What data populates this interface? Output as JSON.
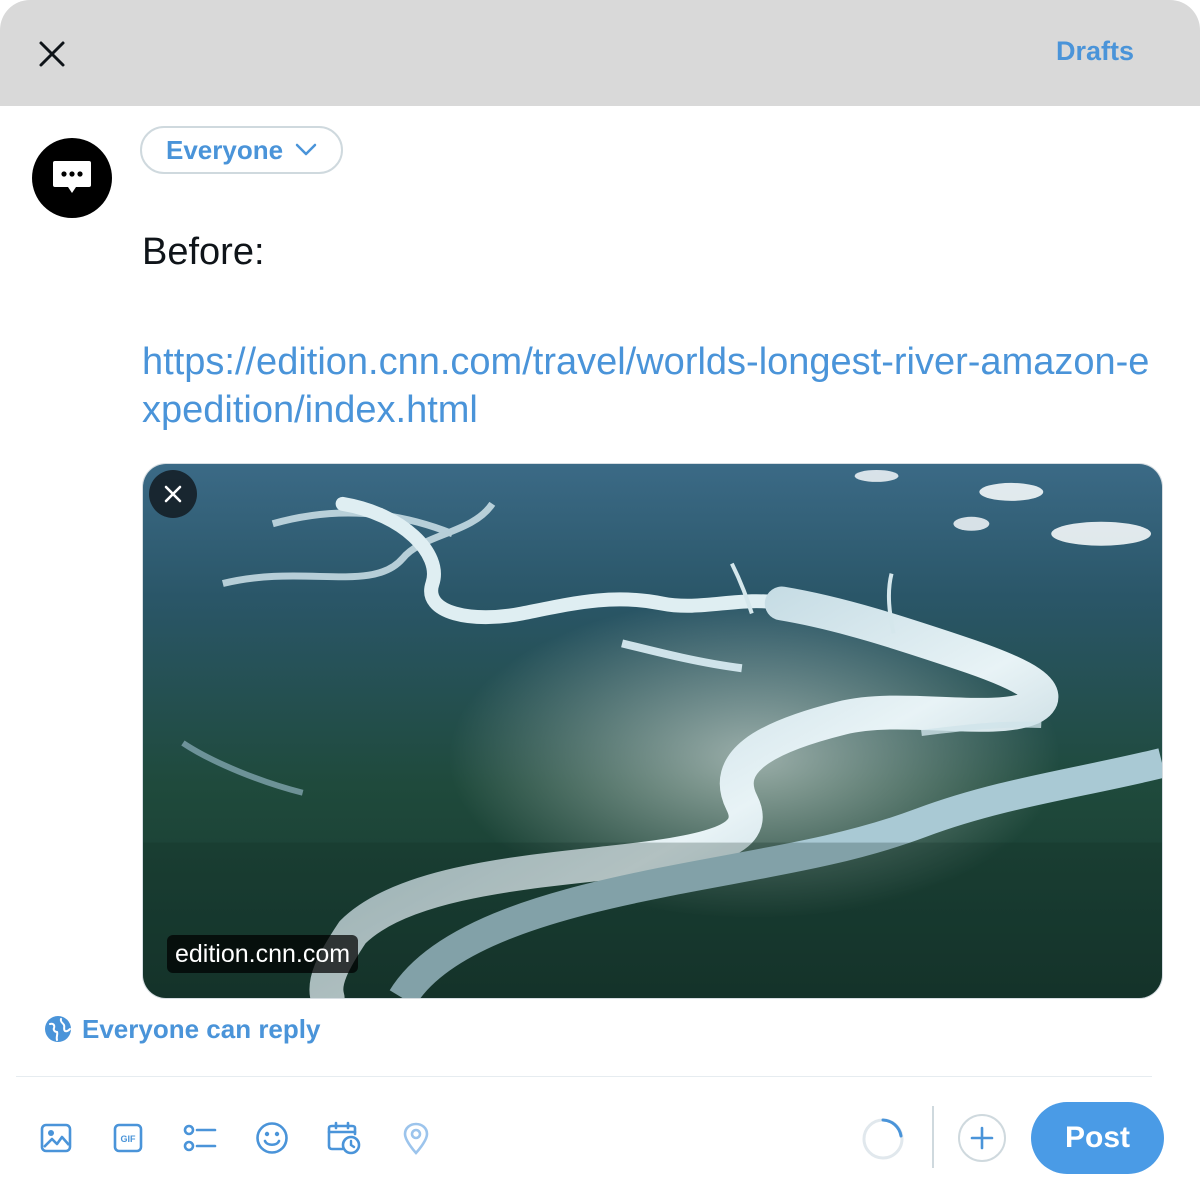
{
  "header": {
    "drafts_label": "Drafts",
    "close_icon": "close-icon"
  },
  "composer": {
    "audience_label": "Everyone",
    "text_line1": "Before:",
    "link_text": "https://edition.cnn.com/travel/worlds-longest-river-amazon-expedition/index.html"
  },
  "link_card": {
    "domain": "edition.cnn.com",
    "image_subject": "aerial view of winding river through rainforest"
  },
  "reply_setting": {
    "label": "Everyone can reply",
    "icon": "globe-icon"
  },
  "toolbar": {
    "icons": [
      "image-icon",
      "gif-icon",
      "poll-icon",
      "emoji-icon",
      "schedule-icon",
      "location-icon"
    ],
    "post_label": "Post"
  },
  "colors": {
    "accent": "#4a94d9",
    "post_button": "#4a9be6",
    "header_bg": "#d9d9d9"
  }
}
